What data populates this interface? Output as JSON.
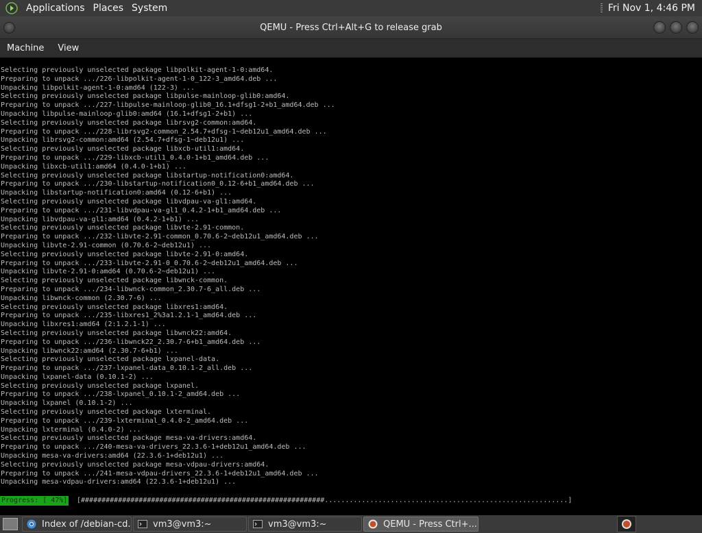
{
  "top_panel": {
    "menus": [
      "Applications",
      "Places",
      "System"
    ],
    "clock": "Fri Nov  1,  4:46 PM"
  },
  "window": {
    "title": "QEMU - Press Ctrl+Alt+G to release grab",
    "menu": [
      "Machine",
      "View"
    ]
  },
  "console": {
    "lines": [
      "Selecting previously unselected package libpolkit-agent-1-0:amd64.",
      "Preparing to unpack .../226-libpolkit-agent-1-0_122-3_amd64.deb ...",
      "Unpacking libpolkit-agent-1-0:amd64 (122-3) ...",
      "Selecting previously unselected package libpulse-mainloop-glib0:amd64.",
      "Preparing to unpack .../227-libpulse-mainloop-glib0_16.1+dfsg1-2+b1_amd64.deb ...",
      "Unpacking libpulse-mainloop-glib0:amd64 (16.1+dfsg1-2+b1) ...",
      "Selecting previously unselected package librsvg2-common:amd64.",
      "Preparing to unpack .../228-librsvg2-common_2.54.7+dfsg-1~deb12u1_amd64.deb ...",
      "Unpacking librsvg2-common:amd64 (2.54.7+dfsg-1~deb12u1) ...",
      "Selecting previously unselected package libxcb-util1:amd64.",
      "Preparing to unpack .../229-libxcb-util1_0.4.0-1+b1_amd64.deb ...",
      "Unpacking libxcb-util1:amd64 (0.4.0-1+b1) ...",
      "Selecting previously unselected package libstartup-notification0:amd64.",
      "Preparing to unpack .../230-libstartup-notification0_0.12-6+b1_amd64.deb ...",
      "Unpacking libstartup-notification0:amd64 (0.12-6+b1) ...",
      "Selecting previously unselected package libvdpau-va-gl1:amd64.",
      "Preparing to unpack .../231-libvdpau-va-gl1_0.4.2-1+b1_amd64.deb ...",
      "Unpacking libvdpau-va-gl1:amd64 (0.4.2-1+b1) ...",
      "Selecting previously unselected package libvte-2.91-common.",
      "Preparing to unpack .../232-libvte-2.91-common_0.70.6-2~deb12u1_amd64.deb ...",
      "Unpacking libvte-2.91-common (0.70.6-2~deb12u1) ...",
      "Selecting previously unselected package libvte-2.91-0:amd64.",
      "Preparing to unpack .../233-libvte-2.91-0_0.70.6-2~deb12u1_amd64.deb ...",
      "Unpacking libvte-2.91-0:amd64 (0.70.6-2~deb12u1) ...",
      "Selecting previously unselected package libwnck-common.",
      "Preparing to unpack .../234-libwnck-common_2.30.7-6_all.deb ...",
      "Unpacking libwnck-common (2.30.7-6) ...",
      "Selecting previously unselected package libxres1:amd64.",
      "Preparing to unpack .../235-libxres1_2%3a1.2.1-1_amd64.deb ...",
      "Unpacking libxres1:amd64 (2:1.2.1-1) ...",
      "Selecting previously unselected package libwnck22:amd64.",
      "Preparing to unpack .../236-libwnck22_2.30.7-6+b1_amd64.deb ...",
      "Unpacking libwnck22:amd64 (2.30.7-6+b1) ...",
      "Selecting previously unselected package lxpanel-data.",
      "Preparing to unpack .../237-lxpanel-data_0.10.1-2_all.deb ...",
      "Unpacking lxpanel-data (0.10.1-2) ...",
      "Selecting previously unselected package lxpanel.",
      "Preparing to unpack .../238-lxpanel_0.10.1-2_amd64.deb ...",
      "Unpacking lxpanel (0.10.1-2) ...",
      "Selecting previously unselected package lxterminal.",
      "Preparing to unpack .../239-lxterminal_0.4.0-2_amd64.deb ...",
      "Unpacking lxterminal (0.4.0-2) ...",
      "Selecting previously unselected package mesa-va-drivers:amd64.",
      "Preparing to unpack .../240-mesa-va-drivers_22.3.6-1+deb12u1_amd64.deb ...",
      "Unpacking mesa-va-drivers:amd64 (22.3.6-1+deb12u1) ...",
      "Selecting previously unselected package mesa-vdpau-drivers:amd64.",
      "Preparing to unpack .../241-mesa-vdpau-drivers_22.3.6-1+deb12u1_amd64.deb ...",
      "Unpacking mesa-vdpau-drivers:amd64 (22.3.6-1+deb12u1) ..."
    ],
    "progress_label": "Progress: [ 47%]",
    "progress_bar": "[###########################################################...........................................................]",
    "progress_percent": 47
  },
  "taskbar": {
    "tasks": [
      {
        "label": "Index of /debian-cd...",
        "icon": "chromium-icon"
      },
      {
        "label": "vm3@vm3:~",
        "icon": "terminal-icon"
      },
      {
        "label": "vm3@vm3:~",
        "icon": "terminal-icon"
      },
      {
        "label": "QEMU - Press Ctrl+...",
        "icon": "qemu-icon"
      }
    ]
  },
  "colors": {
    "panel_bg": "#3a3a3a",
    "console_text": "#bdbdbd",
    "progress_green": "#1aa31a"
  }
}
